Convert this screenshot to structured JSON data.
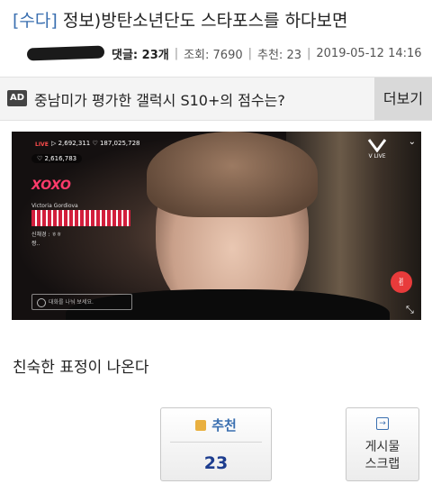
{
  "post": {
    "category": "[수다]",
    "title": " 정보)방탄소년단도 스타포스를 하다보면"
  },
  "meta": {
    "comments_label": "댓글: 23개",
    "sep": "|",
    "views": "조회: 7690",
    "recommend": "추천: 23",
    "datetime": "2019-05-12 14:16"
  },
  "ad": {
    "badge": "AD",
    "text": "중남미가 평가한 갤럭시 S10+의 점수는?",
    "more": "더보기"
  },
  "video": {
    "live": "LIVE",
    "stats": "▷ 2,692,311   ♡ 187,025,728",
    "hearts": "♡ 2,616,783",
    "channel": "V LIVE",
    "sticker": "XOXO",
    "chat_user": "Victoria Gordiova",
    "chat_line1": "신채경 : ㅎㅎ",
    "chat_line2": "짱..",
    "chat_placeholder": "대화를 나눠 보세요."
  },
  "caption": "친숙한 표정이 나온다",
  "recommend_box": {
    "label": "추천",
    "count": "23"
  },
  "scrap_box": {
    "line1": "게시물",
    "line2": "스크랩"
  },
  "colors": {
    "category": "#3a6fb0",
    "count": "#1d3d8f",
    "heart": "#e83b3b"
  }
}
